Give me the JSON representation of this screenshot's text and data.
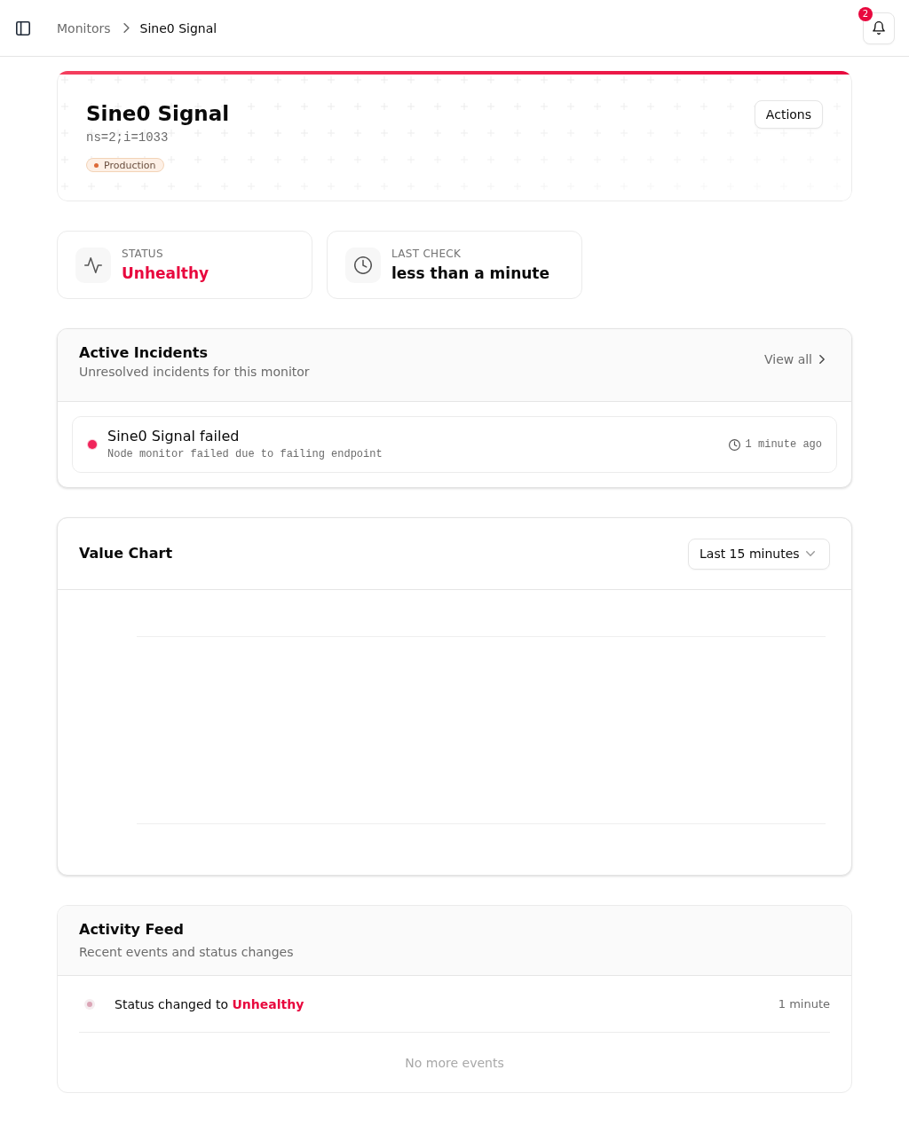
{
  "topbar": {
    "breadcrumbs": [
      {
        "label": "Monitors",
        "current": false
      },
      {
        "label": "Sine0 Signal",
        "current": true
      }
    ],
    "notifications": {
      "count": "2"
    }
  },
  "monitor": {
    "name": "Sine0 Signal",
    "node_id": "ns=2;i=1033",
    "environment": {
      "label": "Production"
    },
    "actions_button": "Actions"
  },
  "stats": [
    {
      "kind": "status",
      "label": "STATUS",
      "value": "Unhealthy",
      "color": "#e8083e"
    },
    {
      "kind": "time",
      "label": "LAST CHECK",
      "value": "less than a minute",
      "color": "#0a0a0a"
    }
  ],
  "incidents": {
    "title": "Active Incidents",
    "subtitle": "Unresolved incidents for this monitor",
    "view_all": "View all",
    "items": [
      {
        "title": "Sine0 Signal failed",
        "description": "Node monitor failed due to failing endpoint",
        "time": "1 minute ago"
      }
    ]
  },
  "value_chart": {
    "title": "Value Chart",
    "range_select": {
      "value": "Last 15 minutes"
    }
  },
  "activity": {
    "title": "Activity Feed",
    "subtitle": "Recent events and status changes",
    "events": [
      {
        "text": "Status changed to **Unhealthy**",
        "time": "1 minute"
      }
    ],
    "end_note": "No more events"
  }
}
